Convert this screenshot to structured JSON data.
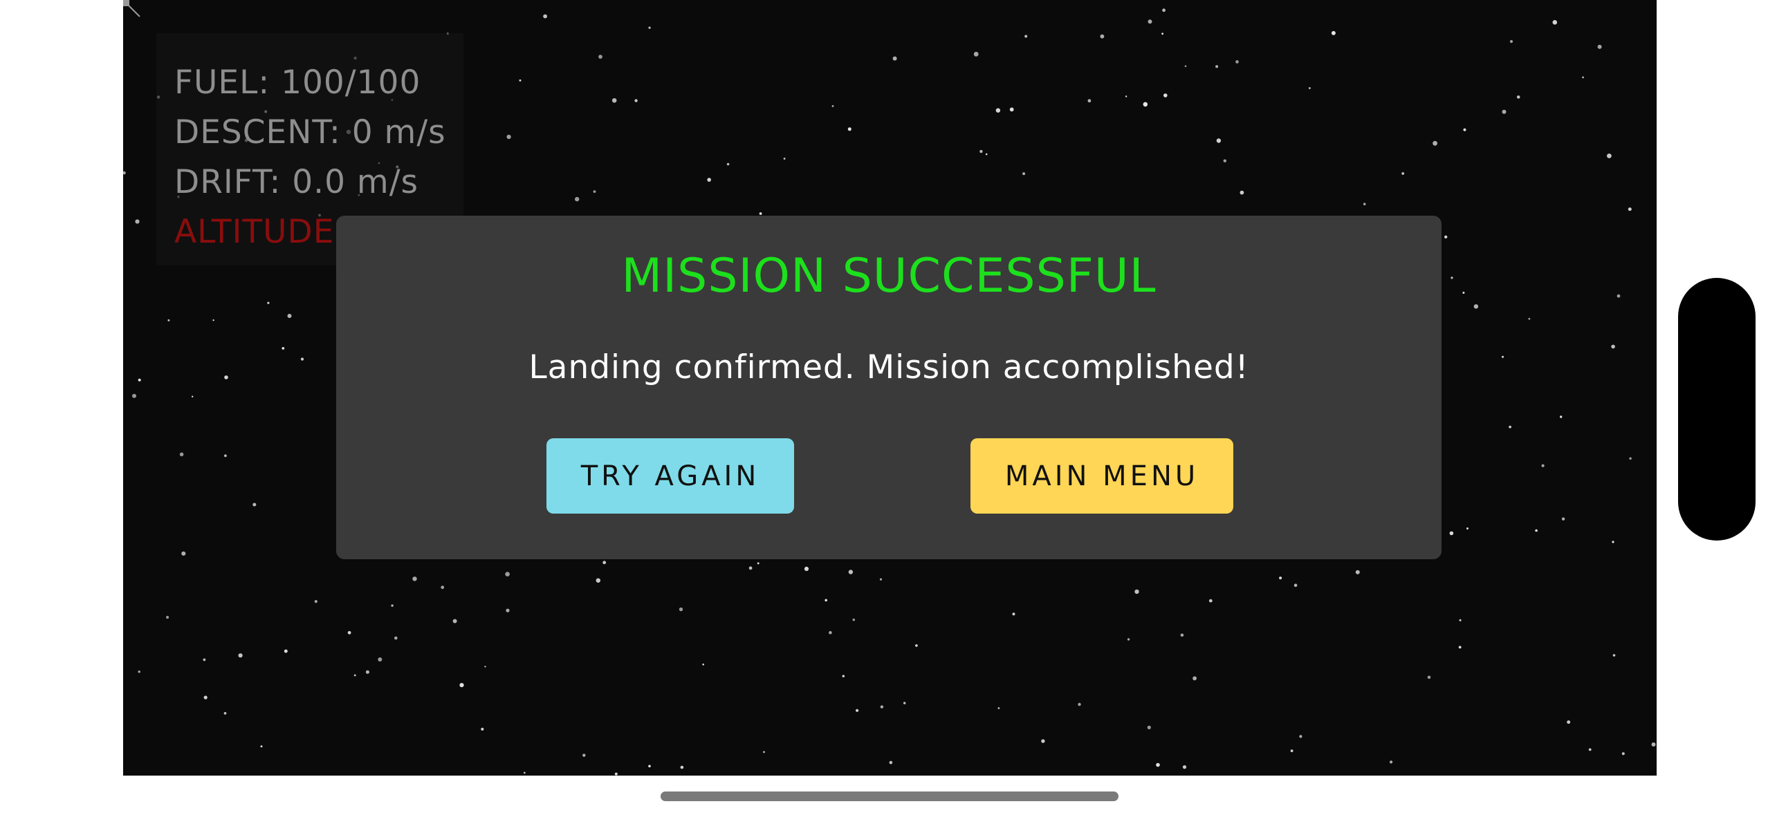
{
  "hud": {
    "fuel": "FUEL: 100/100",
    "descent": "DESCENT: 0 m/s",
    "drift": "DRIFT: 0.0 m/s",
    "altitude": "ALTITUDE"
  },
  "dialog": {
    "title": "MISSION SUCCESSFUL",
    "message": "Landing confirmed. Mission accomplished!",
    "try_again_label": "TRY AGAIN",
    "main_menu_label": "MAIN MENU"
  },
  "colors": {
    "title_green": "#1de01d",
    "altitude_red": "#8a0d0d",
    "try_again_bg": "#7fdbe9",
    "main_menu_bg": "#ffd655",
    "dialog_bg": "#3a3a3a",
    "space_bg": "#0a0a0a"
  }
}
